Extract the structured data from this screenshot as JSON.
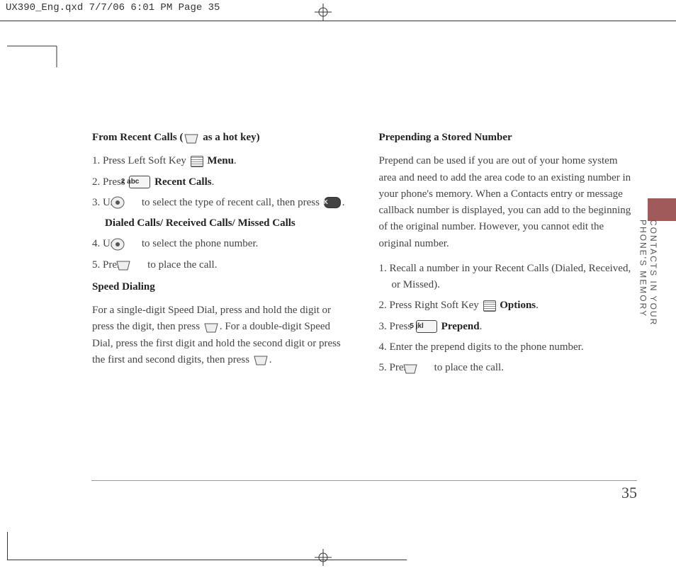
{
  "crop_info": "UX390_Eng.qxd  7/7/06  6:01 PM  Page 35",
  "page_number": "35",
  "side_label_line1": "CONTACTS IN YOUR",
  "side_label_line2": "PHONE'S MEMORY",
  "left": {
    "h1_pre": "From Recent Calls (",
    "h1_post": " as a hot key)",
    "s1_a": "1. Press Left Soft Key ",
    "s1_b": "Menu",
    "s1_c": ".",
    "s2_a": "2. Press ",
    "s2_key": "2 abc",
    "s2_b": "Recent Calls",
    "s2_c": ".",
    "s3_a": "3. Use ",
    "s3_b": " to select the type of recent call, then press ",
    "s3_ok": "OK",
    "s3_c": ".",
    "sub": "Dialed Calls/ Received Calls/ Missed Calls",
    "s4_a": "4. Use ",
    "s4_b": " to select the phone number.",
    "s5_a": "5. Press ",
    "s5_b": " to place the call.",
    "h2": "Speed Dialing",
    "p1_a": "For a single-digit Speed Dial, press and hold the digit or press the digit, then press ",
    "p1_b": ". For a double-digit Speed Dial, press the first digit and hold the second digit or press the first and second digits, then press ",
    "p1_c": "."
  },
  "right": {
    "h1": "Prepending a Stored Number",
    "p1": "Prepend can be used if you are out of your home system area and need to add the area code to an existing number in your phone's memory. When a Contacts entry or message callback number is displayed, you can add to the beginning of the original number. However, you cannot edit the original number.",
    "s1": "1. Recall a number in your Recent Calls (Dialed, Received, or Missed).",
    "s2_a": "2. Press Right Soft Key ",
    "s2_b": "Options",
    "s2_c": ".",
    "s3_a": "3. Press ",
    "s3_key": "5 jkl",
    "s3_b": "Prepend",
    "s3_c": ".",
    "s4": "4. Enter the prepend digits to the phone number.",
    "s5_a": "5. Press ",
    "s5_b": " to place the call."
  }
}
